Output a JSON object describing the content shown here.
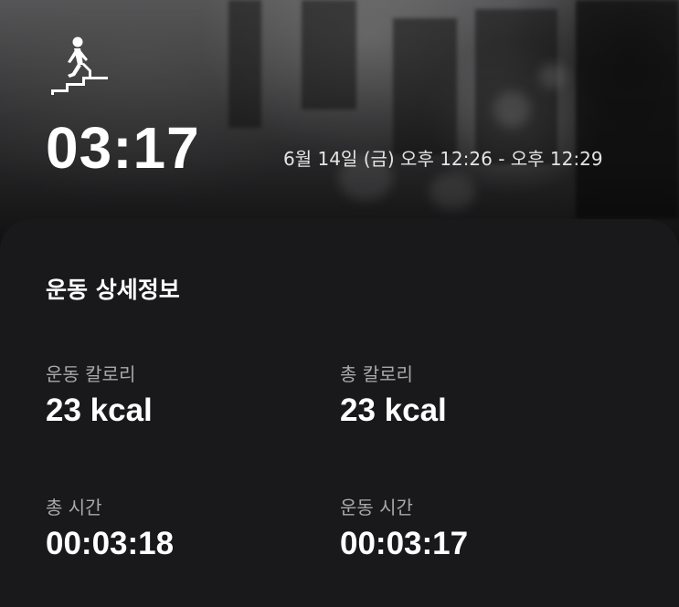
{
  "header": {
    "activity_icon": "stairs-walker-icon",
    "duration": "03:17",
    "date_range": "6월 14일 (금) 오후 12:26 - 오후 12:29"
  },
  "details": {
    "title": "운동 상세정보",
    "stats": [
      {
        "label": "운동 칼로리",
        "value": "23 kcal"
      },
      {
        "label": "총 칼로리",
        "value": "23 kcal"
      },
      {
        "label": "총 시간",
        "value": "00:03:18"
      },
      {
        "label": "운동 시간",
        "value": "00:03:17"
      }
    ]
  },
  "colors": {
    "background": "#141416",
    "card": "#19191b",
    "text_primary": "#ffffff",
    "text_secondary": "#a9a9ab"
  }
}
